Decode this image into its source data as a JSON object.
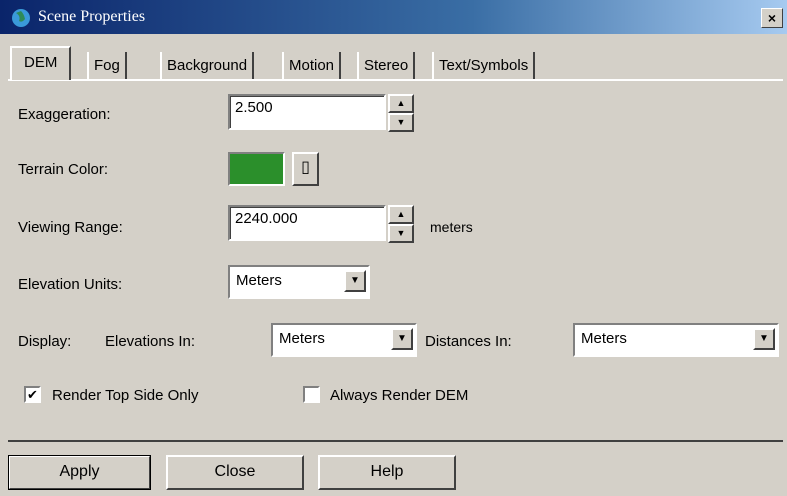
{
  "window": {
    "title": "Scene Properties",
    "close_glyph": "×",
    "icon": "globe-icon"
  },
  "tabs": [
    {
      "label": "DEM",
      "active": true
    },
    {
      "label": "Fog"
    },
    {
      "label": "Background"
    },
    {
      "label": "Motion"
    },
    {
      "label": "Stereo"
    },
    {
      "label": "Text/Symbols"
    }
  ],
  "dem": {
    "exaggeration_label": "Exaggeration:",
    "exaggeration_value": "2.500",
    "terrain_color_label": "Terrain Color:",
    "terrain_color": "#2b8f2b",
    "viewing_range_label": "Viewing Range:",
    "viewing_range_value": "2240.000",
    "viewing_range_unit": "meters",
    "elevation_units_label": "Elevation Units:",
    "elevation_units_value": "Meters",
    "display_label": "Display:",
    "elevations_in_label": "Elevations In:",
    "elevations_in_value": "Meters",
    "distances_in_label": "Distances In:",
    "distances_in_value": "Meters",
    "render_top_label": "Render Top Side Only",
    "render_top_checked": true,
    "always_render_label": "Always Render DEM",
    "always_render_checked": false
  },
  "buttons": {
    "apply": "Apply",
    "close": "Close",
    "help": "Help"
  },
  "glyphs": {
    "up": "▲",
    "down": "▼",
    "check": "✔",
    "color_dialog": "▯"
  }
}
